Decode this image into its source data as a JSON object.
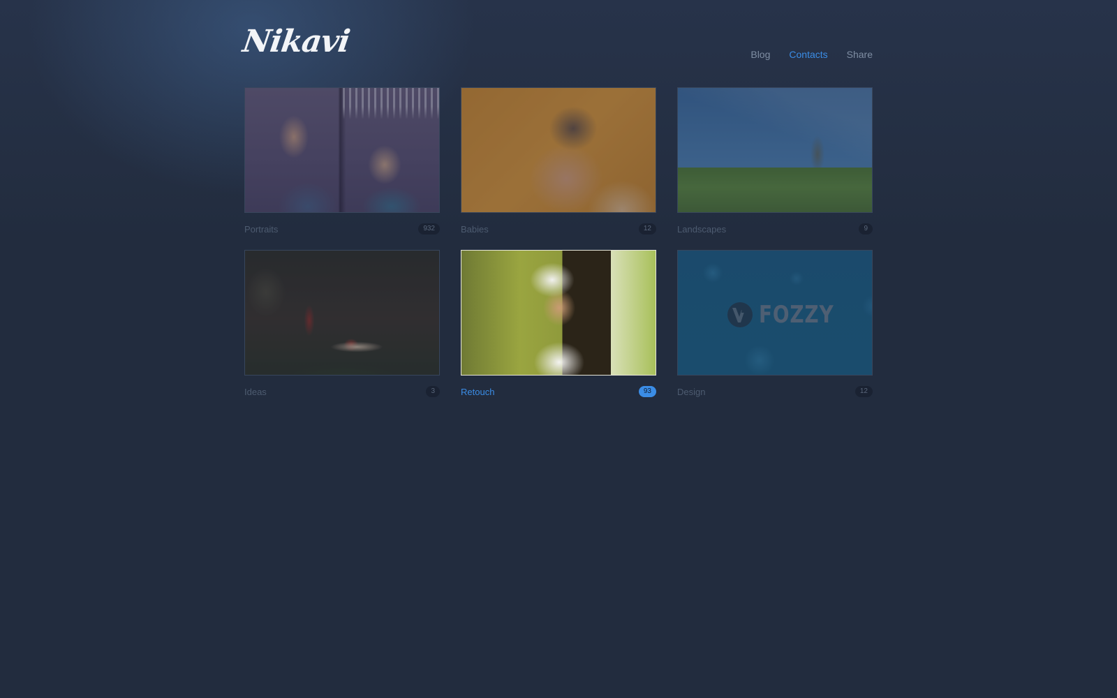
{
  "site": {
    "logo": "Nikavi"
  },
  "nav": {
    "items": [
      {
        "label": "Blog",
        "active": false
      },
      {
        "label": "Contacts",
        "active": true
      },
      {
        "label": "Share",
        "active": false
      }
    ]
  },
  "gallery": {
    "items": [
      {
        "label": "Portraits",
        "count": "932",
        "active": false
      },
      {
        "label": "Babies",
        "count": "12",
        "active": false
      },
      {
        "label": "Landscapes",
        "count": "9",
        "active": false
      },
      {
        "label": "Ideas",
        "count": "3",
        "active": false
      },
      {
        "label": "Retouch",
        "count": "93",
        "active": true
      },
      {
        "label": "Design",
        "count": "12",
        "active": false,
        "logo_text": "FOZZY"
      }
    ]
  },
  "colors": {
    "background": "#222c3e",
    "accent": "#3b8de6",
    "muted_text": "#4d5b70",
    "nav_text": "#7f8ea3"
  }
}
